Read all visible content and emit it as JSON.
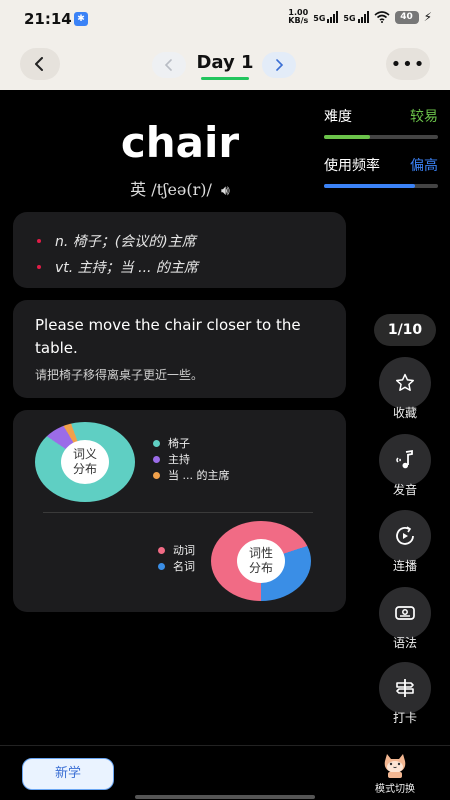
{
  "status_bar": {
    "time": "21:14",
    "net_speed_value": "1.00",
    "net_speed_unit": "KB/s",
    "signal1": "5G",
    "signal2": "5G",
    "battery": "40"
  },
  "header": {
    "title": "Day 1",
    "back_icon": "chevron-left-icon",
    "more_icon": "more-horizontal-icon",
    "accent": "#22c55e"
  },
  "word": {
    "text": "chair",
    "phonetic_label": "英",
    "phonetic": "/tʃeə(r)/"
  },
  "meters": {
    "difficulty": {
      "label": "难度",
      "value": "较易",
      "color": "#6bc34a",
      "level": 0.4
    },
    "frequency": {
      "label": "使用频率",
      "value": "偏高",
      "color": "#3b82f6",
      "level": 0.8
    }
  },
  "definitions": [
    "n. 椅子；(会议的)主席",
    "vt. 主持；当 ... 的主席"
  ],
  "example": {
    "en": "Please move the chair closer to the table.",
    "zh": "请把椅子移得离桌子更近一些。"
  },
  "meaning_distribution": {
    "label_line1": "词义",
    "label_line2": "分布",
    "legend": [
      {
        "label": "椅子",
        "color": "#5fcfc3",
        "share": 0.9
      },
      {
        "label": "主持",
        "color": "#9b6ce8",
        "share": 0.07
      },
      {
        "label": "当 ... 的主席",
        "color": "#f0a04b",
        "share": 0.03
      }
    ]
  },
  "pos_distribution": {
    "label_line1": "词性",
    "label_line2": "分布",
    "legend": [
      {
        "label": "动词",
        "color": "#f16b85",
        "share": 0.7
      },
      {
        "label": "名词",
        "color": "#3a8ee6",
        "share": 0.3
      }
    ]
  },
  "counter": "1/10",
  "side_actions": [
    {
      "label": "收藏",
      "icon": "star-icon"
    },
    {
      "label": "发音",
      "icon": "music-note-icon"
    },
    {
      "label": "连播",
      "icon": "autoplay-icon"
    },
    {
      "label": "语法",
      "icon": "grammar-icon"
    },
    {
      "label": "打卡",
      "icon": "signpost-icon"
    }
  ],
  "bottom": {
    "new_label": "新学",
    "mode_label": "模式切换",
    "mode_icon": "cat-icon"
  }
}
